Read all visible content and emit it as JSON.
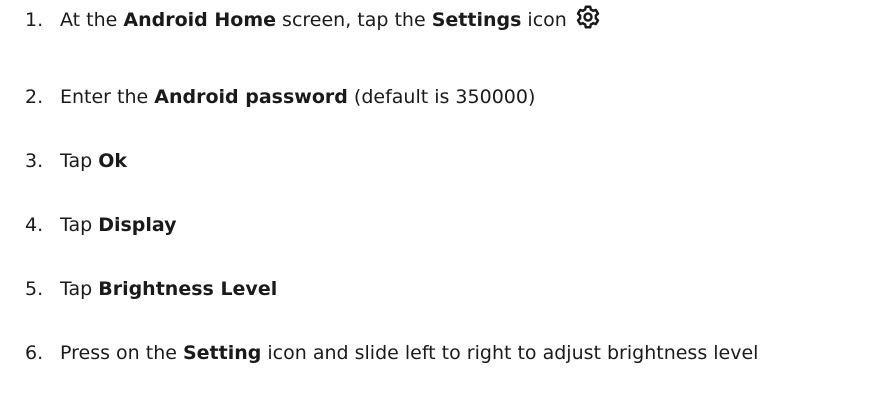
{
  "steps": [
    {
      "number": "1.",
      "t1": "At the ",
      "b1": "Android Home",
      "t2": " screen, tap the ",
      "b2": "Settings",
      "t3": " icon",
      "icon": "settings-gear-icon"
    },
    {
      "number": "2.",
      "t1": "Enter the ",
      "b1": "Android password",
      "t2": " (default is 350000)"
    },
    {
      "number": "3.",
      "t1": "Tap ",
      "b1": "Ok"
    },
    {
      "number": "4.",
      "t1": "Tap ",
      "b1": "Display"
    },
    {
      "number": "5.",
      "t1": "Tap ",
      "b1": "Brightness Level"
    },
    {
      "number": "6.",
      "t1": "Press on the ",
      "b1": "Setting",
      "t2": " icon and slide left to right to adjust brightness level"
    }
  ]
}
